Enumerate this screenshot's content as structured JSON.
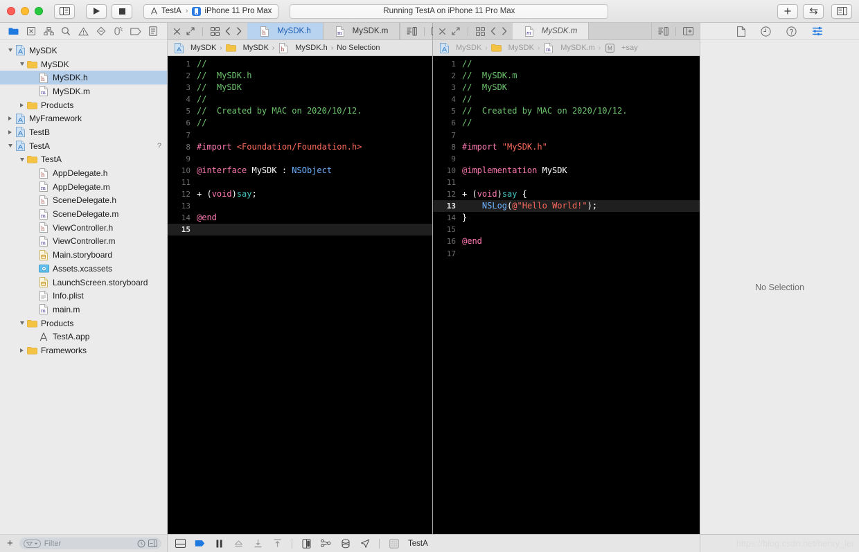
{
  "window": {
    "traffic_lights": [
      "close",
      "minimize",
      "zoom"
    ],
    "toolbar": {
      "sidebar_toggle": "toggle-navigator",
      "run_label": "Run",
      "stop_label": "Stop",
      "scheme_name": "TestA",
      "destination_name": "iPhone 11 Pro Max",
      "status_text": "Running TestA on iPhone 11 Pro Max",
      "add_label": "+",
      "assistant_label": "Assistant Editor",
      "inspector_toggle": "toggle-inspector"
    }
  },
  "navigator": {
    "toolbar_icons": [
      "project-navigator-icon",
      "source-control-navigator-icon",
      "symbol-navigator-icon",
      "find-navigator-icon",
      "issue-navigator-icon",
      "test-navigator-icon",
      "debug-navigator-icon",
      "breakpoint-navigator-icon",
      "report-navigator-icon"
    ],
    "tree": [
      {
        "label": "MySDK",
        "indent": 0,
        "icon": "xcode-project",
        "twisty": "down",
        "selected": false
      },
      {
        "label": "MySDK",
        "indent": 1,
        "icon": "folder",
        "twisty": "down",
        "selected": false
      },
      {
        "label": "MySDK.h",
        "indent": 2,
        "icon": "header-file",
        "twisty": "none",
        "selected": true
      },
      {
        "label": "MySDK.m",
        "indent": 2,
        "icon": "source-file",
        "twisty": "none",
        "selected": false
      },
      {
        "label": "Products",
        "indent": 1,
        "icon": "folder",
        "twisty": "right",
        "selected": false
      },
      {
        "label": "MyFramework",
        "indent": 0,
        "icon": "xcode-project",
        "twisty": "right",
        "selected": false
      },
      {
        "label": "TestB",
        "indent": 0,
        "icon": "xcode-project",
        "twisty": "right",
        "selected": false
      },
      {
        "label": "TestA",
        "indent": 0,
        "icon": "xcode-project",
        "twisty": "down",
        "selected": false,
        "badge": "?"
      },
      {
        "label": "TestA",
        "indent": 1,
        "icon": "folder",
        "twisty": "down",
        "selected": false
      },
      {
        "label": "AppDelegate.h",
        "indent": 2,
        "icon": "header-file",
        "twisty": "none",
        "selected": false
      },
      {
        "label": "AppDelegate.m",
        "indent": 2,
        "icon": "source-file",
        "twisty": "none",
        "selected": false
      },
      {
        "label": "SceneDelegate.h",
        "indent": 2,
        "icon": "header-file",
        "twisty": "none",
        "selected": false
      },
      {
        "label": "SceneDelegate.m",
        "indent": 2,
        "icon": "source-file",
        "twisty": "none",
        "selected": false
      },
      {
        "label": "ViewController.h",
        "indent": 2,
        "icon": "header-file",
        "twisty": "none",
        "selected": false
      },
      {
        "label": "ViewController.m",
        "indent": 2,
        "icon": "source-file",
        "twisty": "none",
        "selected": false
      },
      {
        "label": "Main.storyboard",
        "indent": 2,
        "icon": "storyboard",
        "twisty": "none",
        "selected": false
      },
      {
        "label": "Assets.xcassets",
        "indent": 2,
        "icon": "assets",
        "twisty": "none",
        "selected": false
      },
      {
        "label": "LaunchScreen.storyboard",
        "indent": 2,
        "icon": "storyboard",
        "twisty": "none",
        "selected": false
      },
      {
        "label": "Info.plist",
        "indent": 2,
        "icon": "plist",
        "twisty": "none",
        "selected": false
      },
      {
        "label": "main.m",
        "indent": 2,
        "icon": "source-file",
        "twisty": "none",
        "selected": false
      },
      {
        "label": "Products",
        "indent": 1,
        "icon": "folder",
        "twisty": "down",
        "selected": false
      },
      {
        "label": "TestA.app",
        "indent": 2,
        "icon": "app-bundle",
        "twisty": "none",
        "selected": false
      },
      {
        "label": "Frameworks",
        "indent": 1,
        "icon": "folder",
        "twisty": "right",
        "selected": false
      }
    ],
    "filter": {
      "placeholder": "Filter",
      "add_label": "+"
    }
  },
  "editor_left": {
    "tabs": [
      {
        "label": "MySDK.h",
        "icon": "header-file",
        "active": true
      },
      {
        "label": "MySDK.m",
        "icon": "source-file",
        "active": false
      }
    ],
    "jumpbar": [
      "MySDK",
      "MySDK",
      "MySDK.h",
      "No Selection"
    ],
    "jumpbar_icons": [
      "xcode-project",
      "folder",
      "header-file",
      "none"
    ],
    "lines": [
      {
        "n": 1,
        "tokens": [
          {
            "t": "//",
            "c": "com"
          }
        ]
      },
      {
        "n": 2,
        "tokens": [
          {
            "t": "//  MySDK.h",
            "c": "com"
          }
        ]
      },
      {
        "n": 3,
        "tokens": [
          {
            "t": "//  MySDK",
            "c": "com"
          }
        ]
      },
      {
        "n": 4,
        "tokens": [
          {
            "t": "//",
            "c": "com"
          }
        ]
      },
      {
        "n": 5,
        "tokens": [
          {
            "t": "//  Created by MAC on 2020/10/12.",
            "c": "com"
          }
        ]
      },
      {
        "n": 6,
        "tokens": [
          {
            "t": "//",
            "c": "com"
          }
        ]
      },
      {
        "n": 7,
        "tokens": []
      },
      {
        "n": 8,
        "tokens": [
          {
            "t": "#import ",
            "c": "pre"
          },
          {
            "t": "<Foundation/Foundation.h>",
            "c": "str"
          }
        ]
      },
      {
        "n": 9,
        "tokens": []
      },
      {
        "n": 10,
        "tokens": [
          {
            "t": "@interface",
            "c": "kw"
          },
          {
            "t": " MySDK : ",
            "c": "id"
          },
          {
            "t": "NSObject",
            "c": "typ"
          }
        ]
      },
      {
        "n": 11,
        "tokens": []
      },
      {
        "n": 12,
        "tokens": [
          {
            "t": "+ (",
            "c": "id"
          },
          {
            "t": "void",
            "c": "kw"
          },
          {
            "t": ")",
            "c": "id"
          },
          {
            "t": "say",
            "c": "fn"
          },
          {
            "t": ";",
            "c": "id"
          }
        ]
      },
      {
        "n": 13,
        "tokens": []
      },
      {
        "n": 14,
        "tokens": [
          {
            "t": "@end",
            "c": "kw"
          }
        ]
      },
      {
        "n": 15,
        "tokens": [],
        "current": true
      }
    ]
  },
  "editor_right": {
    "tabs": [
      {
        "label": "MySDK.m",
        "icon": "source-file",
        "active": true
      }
    ],
    "jumpbar": [
      "MySDK",
      "MySDK",
      "MySDK.m",
      "+say"
    ],
    "jumpbar_icons": [
      "xcode-project",
      "folder",
      "source-file",
      "method"
    ],
    "lines": [
      {
        "n": 1,
        "tokens": [
          {
            "t": "//",
            "c": "com"
          }
        ]
      },
      {
        "n": 2,
        "tokens": [
          {
            "t": "//  MySDK.m",
            "c": "com"
          }
        ]
      },
      {
        "n": 3,
        "tokens": [
          {
            "t": "//  MySDK",
            "c": "com"
          }
        ]
      },
      {
        "n": 4,
        "tokens": [
          {
            "t": "//",
            "c": "com"
          }
        ]
      },
      {
        "n": 5,
        "tokens": [
          {
            "t": "//  Created by MAC on 2020/10/12.",
            "c": "com"
          }
        ]
      },
      {
        "n": 6,
        "tokens": [
          {
            "t": "//",
            "c": "com"
          }
        ]
      },
      {
        "n": 7,
        "tokens": []
      },
      {
        "n": 8,
        "tokens": [
          {
            "t": "#import ",
            "c": "pre"
          },
          {
            "t": "\"MySDK.h\"",
            "c": "str"
          }
        ]
      },
      {
        "n": 9,
        "tokens": []
      },
      {
        "n": 10,
        "tokens": [
          {
            "t": "@implementation",
            "c": "kw"
          },
          {
            "t": " MySDK",
            "c": "id"
          }
        ]
      },
      {
        "n": 11,
        "tokens": []
      },
      {
        "n": 12,
        "tokens": [
          {
            "t": "+ (",
            "c": "id"
          },
          {
            "t": "void",
            "c": "kw"
          },
          {
            "t": ")",
            "c": "id"
          },
          {
            "t": "say",
            "c": "fn"
          },
          {
            "t": " {",
            "c": "id"
          }
        ]
      },
      {
        "n": 13,
        "tokens": [
          {
            "t": "    ",
            "c": "id"
          },
          {
            "t": "NSLog",
            "c": "glob"
          },
          {
            "t": "(",
            "c": "id"
          },
          {
            "t": "@\"Hello World!\"",
            "c": "str"
          },
          {
            "t": ");",
            "c": "id"
          }
        ],
        "current": true
      },
      {
        "n": 14,
        "tokens": [
          {
            "t": "}",
            "c": "id"
          }
        ]
      },
      {
        "n": 15,
        "tokens": []
      },
      {
        "n": 16,
        "tokens": [
          {
            "t": "@end",
            "c": "kw"
          }
        ]
      },
      {
        "n": 17,
        "tokens": []
      }
    ]
  },
  "debug_bar": {
    "icons": [
      "hide-debug-area-icon",
      "breakpoints-icon",
      "pause-icon",
      "continue-icon",
      "step-over-icon",
      "step-into-icon",
      "step-out-icon",
      "view-debugging-icon",
      "memory-graph-icon",
      "environment-overrides-icon",
      "location-simulate-icon"
    ],
    "process_label": "TestA"
  },
  "inspector": {
    "tabs": [
      "file-inspector-icon",
      "history-inspector-icon",
      "quick-help-icon",
      "attributes-inspector-icon"
    ],
    "selected_tab_index": 3,
    "empty_text": "No Selection"
  },
  "watermark": "https://blog.csdn.net/henry_lei",
  "colors": {
    "accent": "#1f7ae0",
    "selection": "#b4cde8",
    "tab_active": "#b8d3ef",
    "code_bg": "#000000",
    "comment": "#6ec46e",
    "keyword": "#ff7ab2",
    "string": "#fc6a5d",
    "type": "#6cb3ff",
    "function": "#41c0bb",
    "current_line": "#1f1f1f"
  }
}
